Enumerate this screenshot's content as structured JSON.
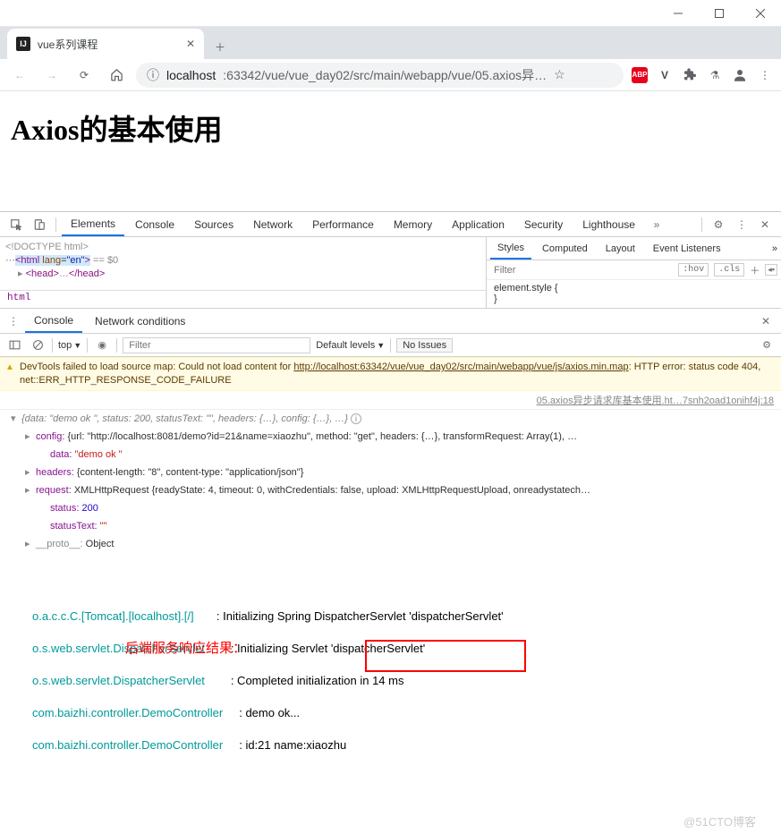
{
  "window": {
    "title": "vue系列课程"
  },
  "tab": {
    "title": "vue系列课程",
    "favicon": "IJ"
  },
  "address": {
    "protocol": "localhost",
    "port_path": ":63342/vue/vue_day02/src/main/webapp/vue/05.axios异…"
  },
  "page": {
    "heading": "Axios的基本使用"
  },
  "devtools": {
    "tabs": [
      "Elements",
      "Console",
      "Sources",
      "Network",
      "Performance",
      "Memory",
      "Application",
      "Security",
      "Lighthouse"
    ],
    "active_tab": "Elements",
    "dom_lines": {
      "l0": "<!DOCTYPE html>",
      "l1_open": "<html ",
      "l1_attr": "lang",
      "l1_val": "\"en\"",
      "l1_close": ">",
      "l1_after": " == $0",
      "l2": "<head>…</head>"
    },
    "path": "html",
    "styles": {
      "tabs": [
        "Styles",
        "Computed",
        "Layout",
        "Event Listeners"
      ],
      "filter_placeholder": "Filter",
      "hov": ":hov",
      "cls": ".cls",
      "rule": "element.style {",
      "rule_end": "}"
    }
  },
  "drawer": {
    "tabs": [
      "Console",
      "Network conditions"
    ],
    "toolbar": {
      "top": "top",
      "filter_placeholder": "Filter",
      "levels": "Default levels",
      "noissues": "No Issues"
    },
    "warning": {
      "pre": "DevTools failed to load source map: Could not load content for ",
      "link": "http://localhost:63342/vue/vue_day02/src/main/webapp/vue/js/axios.min.map",
      "post": ": HTTP error: status code 404, net::ERR_HTTP_RESPONSE_CODE_FAILURE"
    },
    "src_link": "05.axios异步请求库基本使用.ht…7snh2oad1onihf4j:18",
    "obj_root": "{data: \"demo ok \", status: 200, statusText: \"\", headers: {…}, config: {…}, …}",
    "obj_config_label": "config: ",
    "obj_config_val": "{url: \"http://localhost:8081/demo?id=21&name=xiaozhu\", method: \"get\", headers: {…}, transformRequest: Array(1), …",
    "obj_data_label": "data: ",
    "obj_data_val": "\"demo ok \"",
    "obj_headers_label": "headers: ",
    "obj_headers_val": "{content-length: \"8\", content-type: \"application/json\"}",
    "obj_request_label": "request: ",
    "obj_request_val": "XMLHttpRequest {readyState: 4, timeout: 0, withCredentials: false, upload: XMLHttpRequestUpload, onreadystatech…",
    "obj_status_label": "status: ",
    "obj_status_val": "200",
    "obj_statustext_label": "statusText: ",
    "obj_statustext_val": "\"\"",
    "obj_proto_label": "__proto__: ",
    "obj_proto_val": "Object"
  },
  "logs": {
    "l0_src": "o.a.c.c.C.[Tomcat].[localhost].[/]",
    "l0_msg": ": Initializing Spring DispatcherServlet 'dispatcherServlet'",
    "l1_src": "o.s.web.servlet.DispatcherServlet",
    "l1_msg": ": Initializing Servlet 'dispatcherServlet'",
    "l2_src": "o.s.web.servlet.DispatcherServlet",
    "l2_msg": ": Completed initialization in 14 ms",
    "l3_src": "com.baizhi.controller.DemoController",
    "l3_msg": ": demo ok...",
    "l4_src": "com.baizhi.controller.DemoController",
    "l4_msg": ": id:21 name:xiaozhu",
    "annotation": "后端服务响应结果：",
    "watermark": "@51CTO博客"
  }
}
